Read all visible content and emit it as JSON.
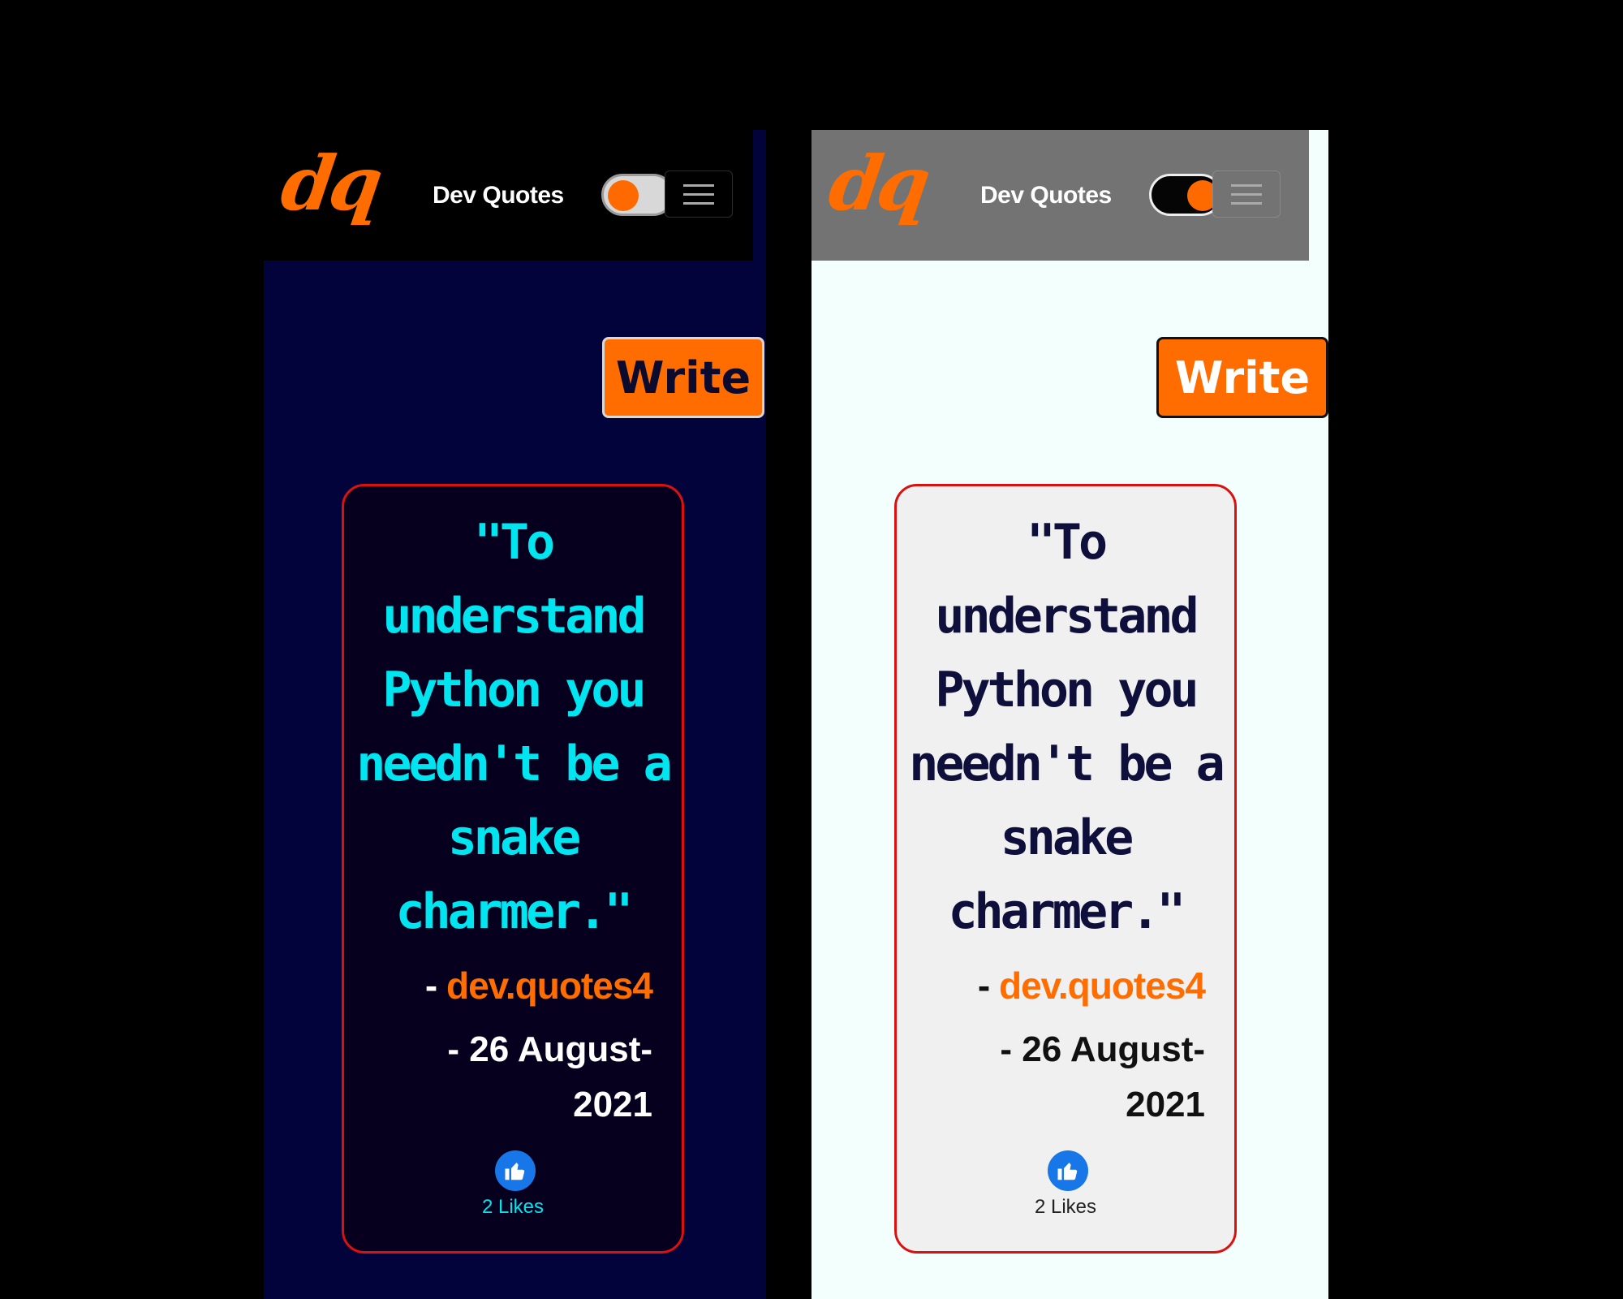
{
  "colors": {
    "accent": "#ff6d00",
    "dark_bg": "#03033b",
    "light_bg": "#f2fffd",
    "card_border": "#dd1010",
    "like_blue": "#1877e8"
  },
  "dark": {
    "logo": "dq",
    "site_title": "Dev Quotes",
    "theme_toggle": "off",
    "menu_icon": "hamburger-icon",
    "write_label": "Write",
    "quote": "\"To\nunderstand\nPython you\nneedn't be a\nsnake\ncharmer.\"",
    "author_prefix": "- ",
    "author": "dev.quotes4",
    "date": "- 26 August-\n2021",
    "like_icon": "thumbs-up-icon",
    "likes": "2 Likes"
  },
  "light": {
    "logo": "dq",
    "site_title": "Dev Quotes",
    "theme_toggle": "on",
    "menu_icon": "hamburger-icon",
    "write_label": "Write",
    "quote": "\"To\nunderstand\nPython you\nneedn't be a\nsnake\ncharmer.\"",
    "author_prefix": "- ",
    "author": "dev.quotes4",
    "date": "- 26 August-\n2021",
    "like_icon": "thumbs-up-icon",
    "likes": "2 Likes"
  }
}
